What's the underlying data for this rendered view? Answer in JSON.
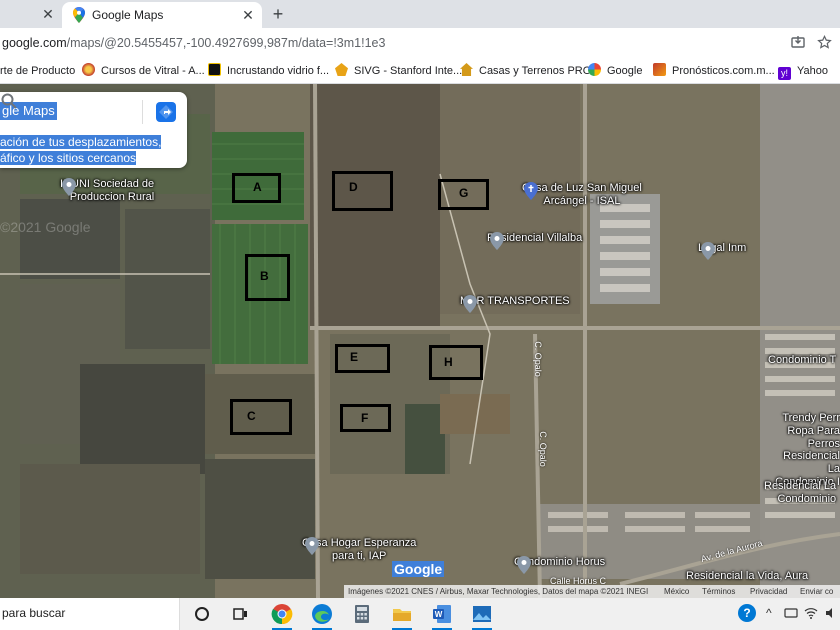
{
  "browser": {
    "tabs": [
      {
        "title": "Google Maps",
        "active": true
      }
    ],
    "new_tab": "+",
    "close_glyph": "✕",
    "url": {
      "host": "google.com",
      "path": "/maps/@20.5455457,-100.4927699,987m/data=!3m1!1e3"
    },
    "bookmarks": [
      {
        "label": "rte de Producto",
        "icon": "bookmark-icon"
      },
      {
        "label": "Cursos de Vitral - A...",
        "icon": "vitral-icon"
      },
      {
        "label": "Incrustando vidrio f...",
        "icon": "video-icon"
      },
      {
        "label": "SIVG - Stanford Inte...",
        "icon": "sivg-icon"
      },
      {
        "label": "Casas y Terrenos PRO",
        "icon": "house-icon"
      },
      {
        "label": "Google",
        "icon": "google-icon"
      },
      {
        "label": "Pronósticos.com.m...",
        "icon": "pronosticos-icon"
      },
      {
        "label": "Yahoo",
        "icon": "yahoo-icon"
      }
    ]
  },
  "maps": {
    "search_text": "gle Maps",
    "suggest_lines": [
      "ación de tus desplazamientos,",
      "áfico y los sitios cercanos"
    ],
    "watermark": "©2021 Google",
    "plots": [
      {
        "label": "A"
      },
      {
        "label": "B"
      },
      {
        "label": "C"
      },
      {
        "label": "D"
      },
      {
        "label": "E"
      },
      {
        "label": "F"
      },
      {
        "label": "G"
      },
      {
        "label": "H"
      }
    ],
    "pois": [
      {
        "name": "INUNI Sociedad de\nProduccion Rural"
      },
      {
        "name": "Casa de Luz San Miguel\nArcángel - ISAL"
      },
      {
        "name": "Residencial Villalba"
      },
      {
        "name": "Legal Inm"
      },
      {
        "name": "M&R TRANSPORTES"
      },
      {
        "name": "Condominio T"
      },
      {
        "name": "Trendy Perr\nRopa Para Perros"
      },
      {
        "name": "Residencial La\nCondominio I"
      },
      {
        "name": "Residencial La\nCondominio"
      },
      {
        "name": "Casa Hogar Esperanza\npara ti, IAP"
      },
      {
        "name": "Condominio Horus"
      },
      {
        "name": "Residencial la Vida, Aura"
      }
    ],
    "streets": [
      "C. Opalo",
      "C. Opalo",
      "Av. de la Aurora",
      "Calle Horus C"
    ],
    "google_logo": "Google",
    "attribution": {
      "credits": "Imágenes ©2021 CNES / Airbus, Maxar Technologies, Datos del mapa ©2021 INEGI",
      "country": "México",
      "terms": "Términos",
      "privacy": "Privacidad",
      "feedback": "Enviar co"
    }
  },
  "taskbar": {
    "search_placeholder": "para buscar",
    "apps": [
      "task-view",
      "chrome",
      "edge",
      "calculator",
      "file-explorer",
      "word",
      "photos"
    ],
    "tray": {
      "help": "?",
      "chevron": "^"
    }
  }
}
